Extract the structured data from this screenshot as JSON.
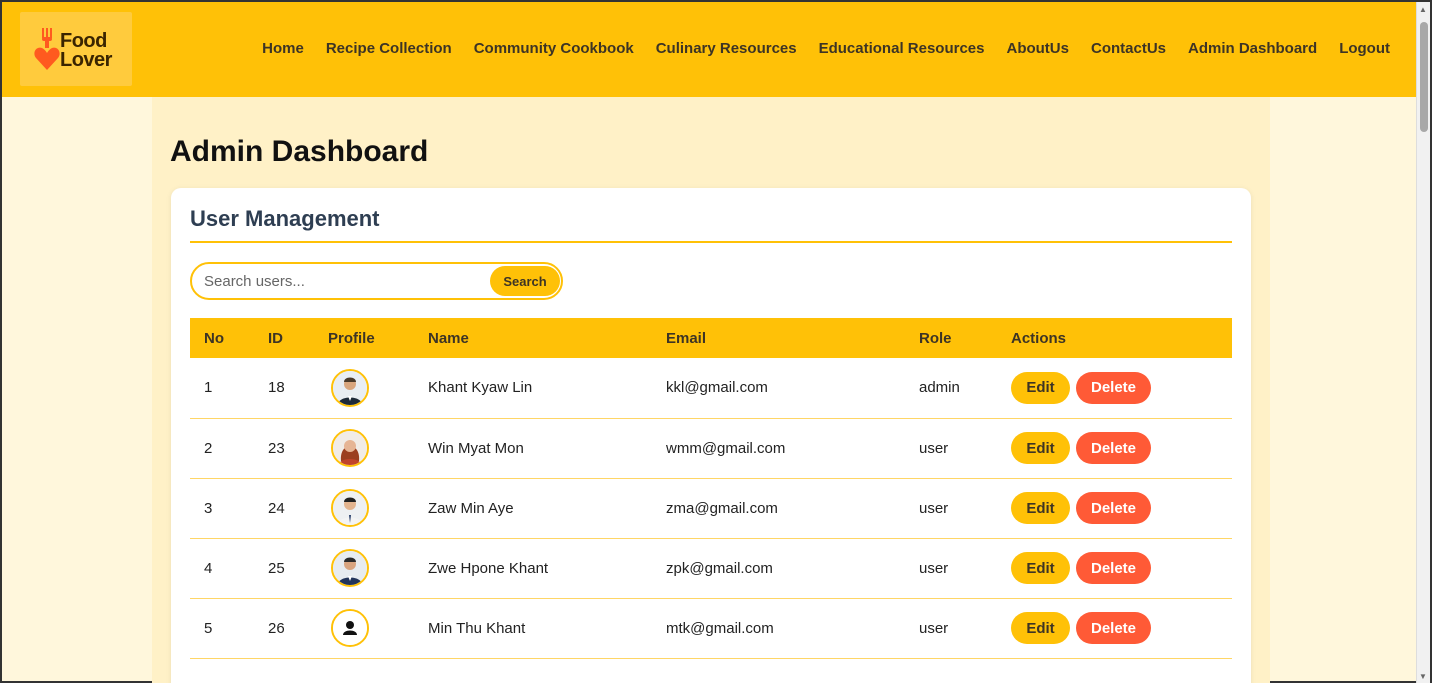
{
  "brand": {
    "logo_line1": "Food",
    "logo_line2": "Lover",
    "color": "#ffc107"
  },
  "nav": {
    "items": [
      {
        "label": "Home"
      },
      {
        "label": "Recipe Collection"
      },
      {
        "label": "Community Cookbook"
      },
      {
        "label": "Culinary Resources"
      },
      {
        "label": "Educational Resources"
      },
      {
        "label": "AboutUs"
      },
      {
        "label": "ContactUs"
      },
      {
        "label": "Admin Dashboard"
      },
      {
        "label": "Logout"
      }
    ]
  },
  "page": {
    "title": "Admin Dashboard"
  },
  "user_management": {
    "title": "User Management",
    "search": {
      "placeholder": "Search users...",
      "value": "",
      "button_label": "Search"
    },
    "columns": [
      "No",
      "ID",
      "Profile",
      "Name",
      "Email",
      "Role",
      "Actions"
    ],
    "rows": [
      {
        "no": "1",
        "id": "18",
        "name": "Khant Kyaw Lin",
        "email": "kkl@gmail.com",
        "role": "admin",
        "avatar": "man-photo-avatar-icon"
      },
      {
        "no": "2",
        "id": "23",
        "name": "Win Myat Mon",
        "email": "wmm@gmail.com",
        "role": "user",
        "avatar": "woman-photo-avatar-icon"
      },
      {
        "no": "3",
        "id": "24",
        "name": "Zaw Min Aye",
        "email": "zma@gmail.com",
        "role": "user",
        "avatar": "man-photo-avatar-icon"
      },
      {
        "no": "4",
        "id": "25",
        "name": "Zwe Hpone Khant",
        "email": "zpk@gmail.com",
        "role": "user",
        "avatar": "man-photo-avatar-icon"
      },
      {
        "no": "5",
        "id": "26",
        "name": "Min Thu Khant",
        "email": "mtk@gmail.com",
        "role": "user",
        "avatar": "default-person-icon"
      }
    ],
    "edit_label": "Edit",
    "delete_label": "Delete"
  },
  "colors": {
    "accent": "#ffc107",
    "delete": "#ff5a36",
    "background": "#fff7dc"
  }
}
